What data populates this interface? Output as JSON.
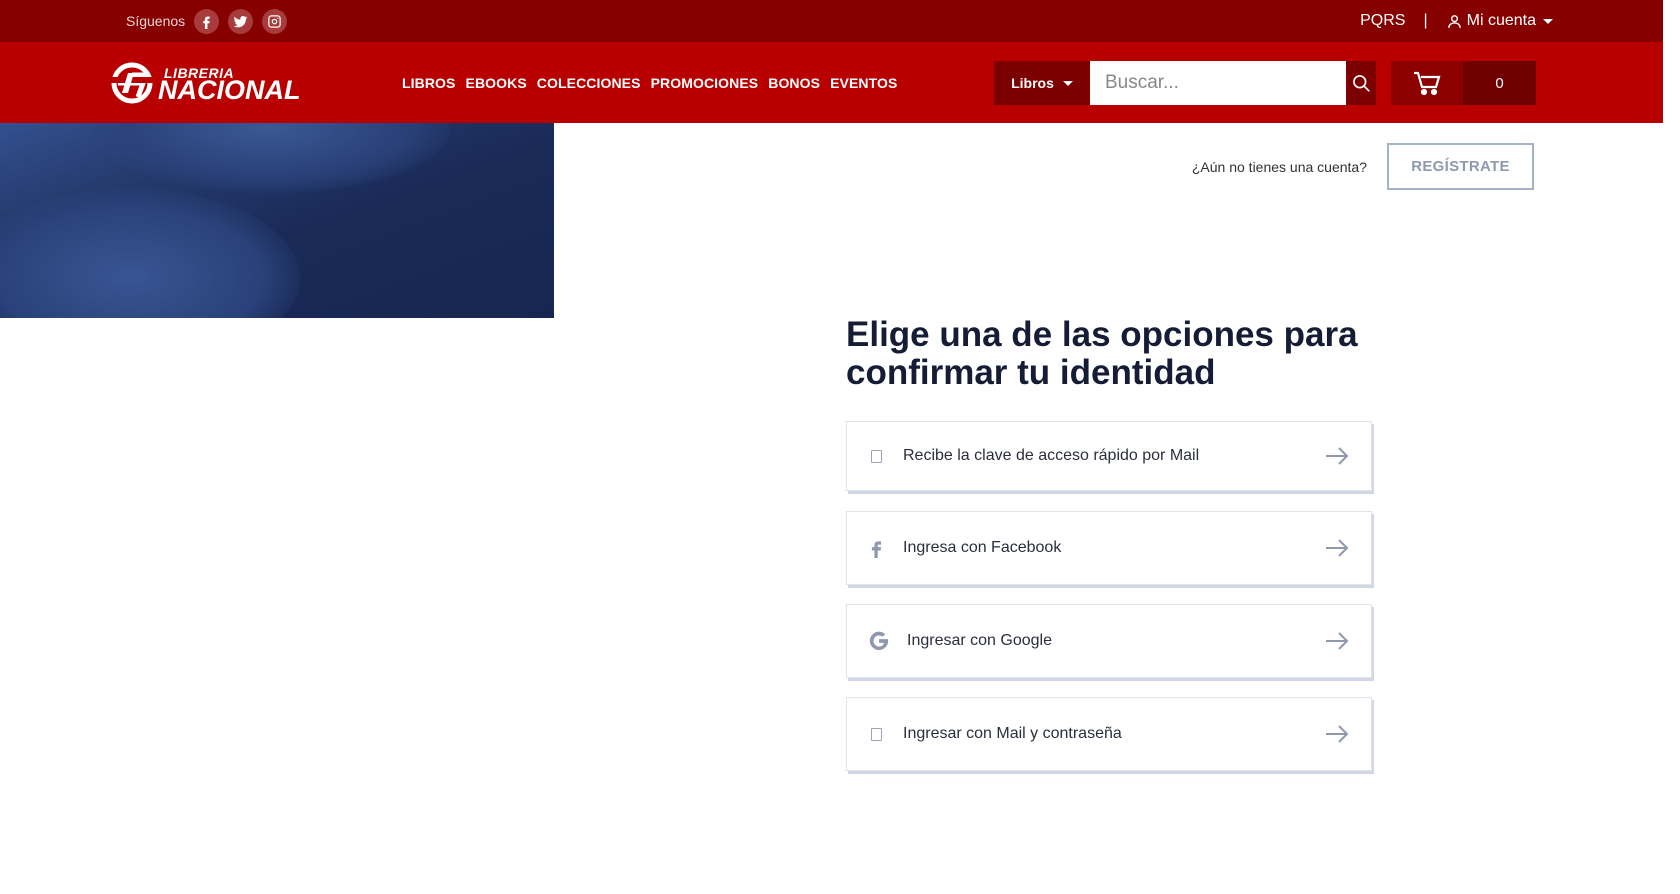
{
  "topbar": {
    "follow_label": "Síguenos",
    "social_icons": [
      "facebook-icon",
      "twitter-icon",
      "instagram-icon"
    ],
    "pqrs": "PQRS",
    "separator": "|",
    "account": "Mi cuenta"
  },
  "navbar": {
    "logo_line1": "LIBRERIA",
    "logo_line2": "NACIONAL",
    "links": [
      "LIBROS",
      "EBOOKS",
      "COLECCIONES",
      "PROMOCIONES",
      "BONOS",
      "EVENTOS"
    ],
    "category_select": "Libros",
    "search_placeholder": "Buscar...",
    "cart_count": "0"
  },
  "main": {
    "register_question": "¿Aún no tienes una cuenta?",
    "register_button": "REGÍSTRATE",
    "title": "Elige una de las opciones para confirmar tu identidad",
    "options": [
      {
        "label": "Recibe la clave de acceso rápido por Mail",
        "icon": "mail-icon"
      },
      {
        "label": "Ingresa con Facebook",
        "icon": "facebook-icon"
      },
      {
        "label": "Ingresar con Google",
        "icon": "google-icon"
      },
      {
        "label": "Ingresar con Mail y contraseña",
        "icon": "mail-icon"
      }
    ]
  },
  "colors": {
    "topbar_bg": "#860000",
    "navbar_bg": "#b80000",
    "title_color": "#141c36"
  }
}
